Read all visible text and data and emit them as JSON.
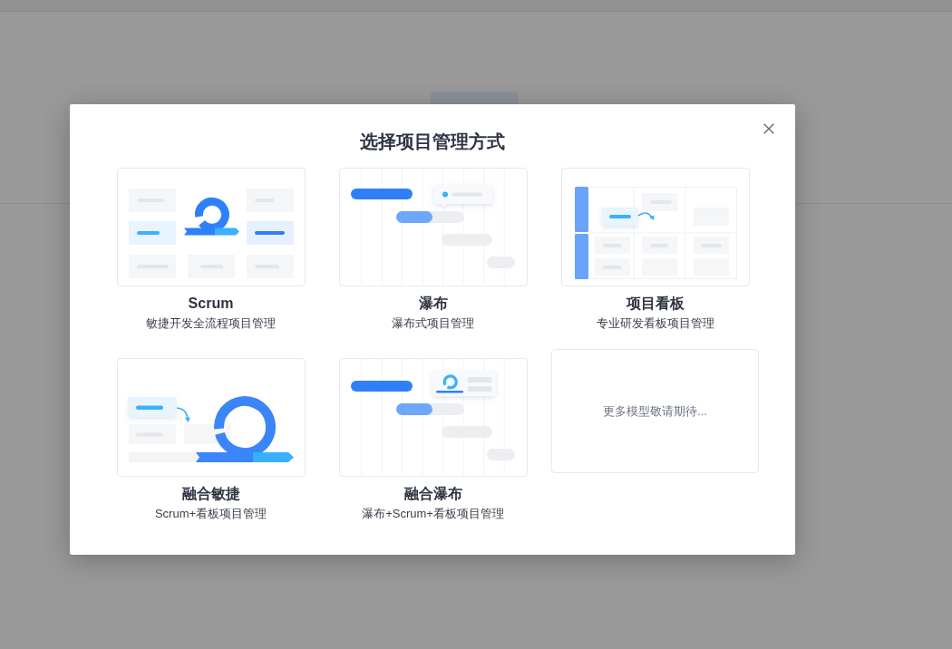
{
  "dialog": {
    "title": "选择项目管理方式"
  },
  "methods": [
    {
      "kind": "scrum",
      "name": "Scrum",
      "description": "敏捷开发全流程项目管理"
    },
    {
      "kind": "waterfall",
      "name": "瀑布",
      "description": "瀑布式项目管理"
    },
    {
      "kind": "kanban",
      "name": "项目看板",
      "description": "专业研发看板项目管理"
    },
    {
      "kind": "agilemix",
      "name": "融合敏捷",
      "description": "Scrum+看板项目管理"
    },
    {
      "kind": "waterfallmix",
      "name": "融合瀑布",
      "description": "瀑布+Scrum+看板项目管理"
    }
  ],
  "more_card": {
    "text": "更多模型敬请期待..."
  }
}
